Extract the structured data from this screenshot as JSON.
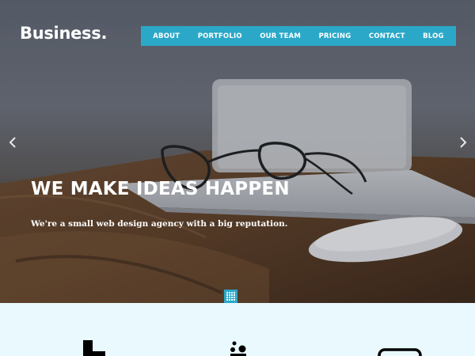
{
  "brand": {
    "name": "Business."
  },
  "nav": {
    "items": [
      "ABOUT",
      "PORTFOLIO",
      "OUR TEAM",
      "PRICING",
      "CONTACT",
      "BLOG"
    ]
  },
  "hero": {
    "headline": "WE MAKE IDEAS HAPPEN",
    "tagline": "We're a small web design agency with a big reputation.",
    "prev_icon": "chevron-left-icon",
    "next_icon": "chevron-right-icon",
    "toggle_icon": "grid-icon"
  },
  "features": {
    "icons": [
      "chess-piece-icon",
      "palette-icon",
      "device-icon"
    ]
  },
  "colors": {
    "accent": "#2ba8c8",
    "feature_background": "#e9f9fd",
    "text_light": "#ffffff"
  }
}
